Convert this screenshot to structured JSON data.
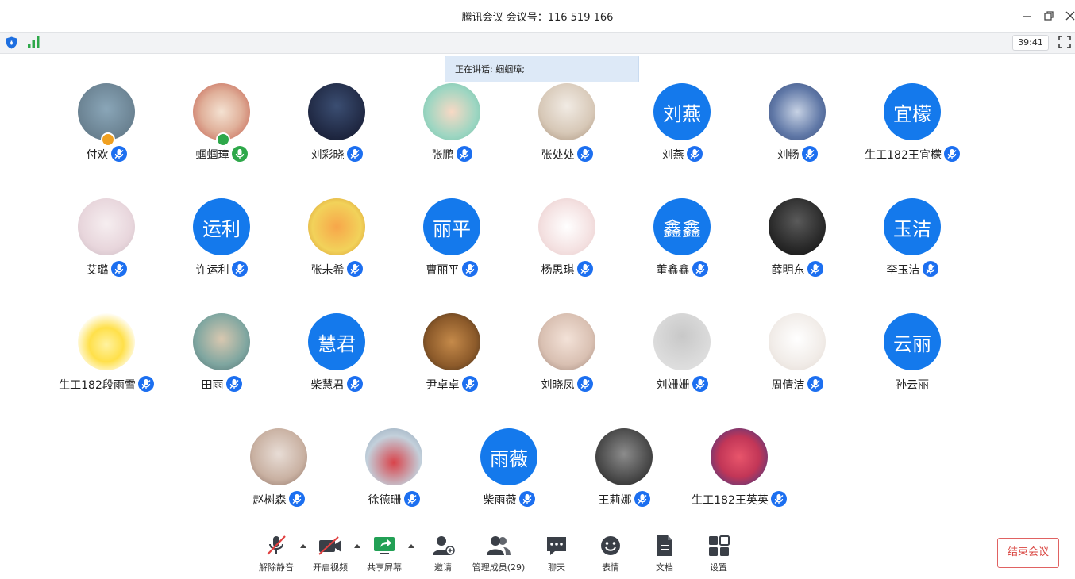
{
  "window": {
    "title": "腾讯会议 会议号：116 519 166"
  },
  "top_toolbar": {
    "timer": "39:41"
  },
  "speaking_banner": "正在讲话: 蝈蝈璋;",
  "participants": [
    {
      "name": "付欢",
      "avatar": "image"
    },
    {
      "name": "蝈蝈璋",
      "avatar": "image"
    },
    {
      "name": "刘彩晓",
      "avatar": "image"
    },
    {
      "name": "张鹏",
      "avatar": "image"
    },
    {
      "name": "张处处",
      "avatar": "image"
    },
    {
      "name": "刘燕",
      "avatar": "刘燕"
    },
    {
      "name": "刘畅",
      "avatar": "image"
    },
    {
      "name": "生工182王宜檬",
      "avatar": "宜檬"
    },
    {
      "name": "艾璐",
      "avatar": "image"
    },
    {
      "name": "许运利",
      "avatar": "运利"
    },
    {
      "name": "张未希",
      "avatar": "image"
    },
    {
      "name": "曹丽平",
      "avatar": "丽平"
    },
    {
      "name": "杨思琪",
      "avatar": "image"
    },
    {
      "name": "董鑫鑫",
      "avatar": "鑫鑫"
    },
    {
      "name": "薛明东",
      "avatar": "image"
    },
    {
      "name": "李玉洁",
      "avatar": "玉洁"
    },
    {
      "name": "生工182段雨雪",
      "avatar": "image"
    },
    {
      "name": "田雨",
      "avatar": "image"
    },
    {
      "name": "柴慧君",
      "avatar": "慧君"
    },
    {
      "name": "尹卓卓",
      "avatar": "image"
    },
    {
      "name": "刘晓凤",
      "avatar": "image"
    },
    {
      "name": "刘姗姗",
      "avatar": "image"
    },
    {
      "name": "周倩洁",
      "avatar": "image"
    },
    {
      "name": "孙云丽",
      "avatar": "云丽"
    },
    {
      "name": "赵树森",
      "avatar": "image"
    },
    {
      "name": "徐德珊",
      "avatar": "image"
    },
    {
      "name": "柴雨薇",
      "avatar": "雨薇"
    },
    {
      "name": "王莉娜",
      "avatar": "image"
    },
    {
      "name": "生工182王英英",
      "avatar": "image"
    }
  ],
  "bottom_toolbar": {
    "unmute": "解除静音",
    "start_video": "开启视频",
    "share_screen": "共享屏幕",
    "invite": "邀请",
    "manage_members": "管理成员(29)",
    "chat": "聊天",
    "reactions": "表情",
    "docs": "文档",
    "settings": "设置",
    "end_meeting": "结束会议"
  },
  "colors": {
    "accent": "#1479ec",
    "mic_blue": "#1c6ff0",
    "mic_active": "#2ea84a",
    "end_red": "#d9443f"
  }
}
